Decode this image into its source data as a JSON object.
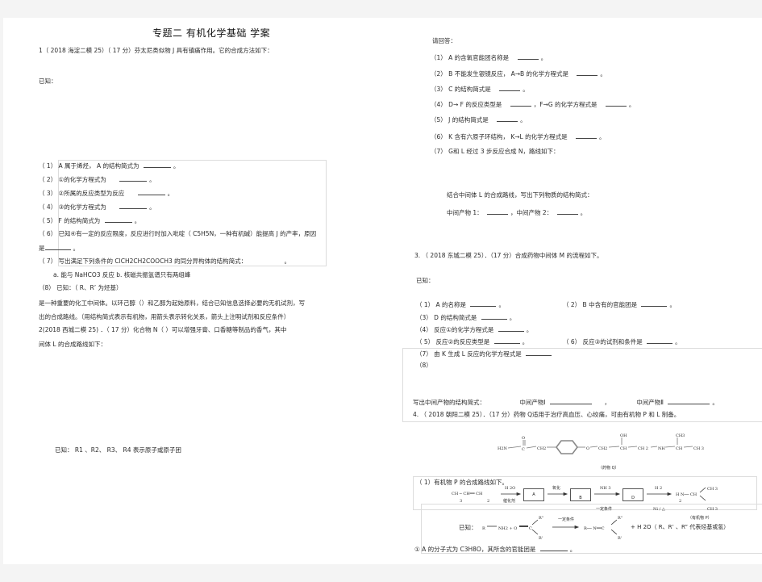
{
  "doc": {
    "title": "专题二  有机化学基础   学案",
    "q1": {
      "header": "1（ 2018 海淀二模  25）（ 17 分）芬太尼类似物  J 具有镇痛作用。它的合成方法如下：",
      "known": "已知：",
      "items": [
        {
          "label": "（ 1）",
          "text": "A 属于烯烃， A 的结构简式为",
          "suffix": "。"
        },
        {
          "label": "（ 2）",
          "text": "①的化学方程式为",
          "suffix": "。"
        },
        {
          "label": "（ 3）",
          "text": "②所属的反应类型为反应",
          "suffix": "。"
        },
        {
          "label": "（ 4）",
          "text": "③的化学方程式为",
          "suffix": "。"
        },
        {
          "label": "（ 5）",
          "text": "F 的结构简式为",
          "suffix": "。"
        },
        {
          "label": "（ 6）",
          "text": "已知④有一定的反应限度，反应进行时加入吡啶（        C5H5N，一种有机碱）能提高    J  的产率，原因"
        },
        {
          "label": "",
          "text": "是",
          "suffix": "。"
        },
        {
          "label": "（ 7）",
          "text": "写出满足下列条件的    ClCH2CH2COOCH3 的同分异构体的结构简式：",
          "suffix": "。"
        },
        {
          "label": "",
          "text": "a. 能与  NaHCO3 反应     b.        核磁共振氢谱只有两组峰"
        },
        {
          "label": "（8）",
          "text": "已知：（ R、R’ 为烃基）"
        }
      ],
      "para1": "是一种重要的化工中间体。以环己醇（）和乙醇为起始原料，结合已知信息选择必要的无机试剂，写",
      "para2": "出的合成路线。（用结构简式表示有机物，用箭头表示转化关系，箭头上注明试剂和反应条件）"
    },
    "q2": {
      "header": "2(2018  西城二模    25)  ．（ 17 分）化合物  N（                   ）可以增强牙膏、口香糖等制品的香气，其中",
      "header2": "间体 L 的合成路线如下：",
      "known": "已知：  R1 、R2、  R3、  R4 表示原子或原子团",
      "please": "请回答：",
      "items": [
        {
          "label": "（1）",
          "text": "A 的含氧官能团名称是",
          "suffix": "。"
        },
        {
          "label": "（2）",
          "text": "B 不能发生银镜反应， A→B 的化学方程式是",
          "suffix": "。"
        },
        {
          "label": "（3）",
          "text": "C 的结构简式是",
          "suffix": "。"
        },
        {
          "label": "（4）",
          "text": "D→ F 的反应类型是",
          "mid": "，F→G 的化学方程式是",
          "suffix": "。"
        },
        {
          "label": "（5）",
          "text": "J 的结构简式是",
          "suffix": "。"
        },
        {
          "label": "（6）",
          "text": "K 含有六原子环结构， K→L 的化学方程式是",
          "suffix": "。"
        },
        {
          "label": "（7）",
          "text": "G和 L 经过 3 步反应合成  N，路线如下："
        }
      ],
      "combine": "结合中间体  L 的合成路线，写出下列物质的结构简式：",
      "intermediate1": "中间产物  1：",
      "intermediate2": "，中间产物  2：",
      "end": "。"
    },
    "q3": {
      "header": "3. （ 2018  东城二模   25）．（17  分）合成药物中间体    M 的流程如下。",
      "known": "已知：",
      "items": [
        {
          "label": "（ 1）",
          "text": "A 的名称是",
          "suffix": "。"
        },
        {
          "label": "（ 2）",
          "text": "B  中含有的官能团是",
          "suffix": "。"
        },
        {
          "label": "（3）",
          "text": "D 的结构简式是",
          "suffix": "。"
        },
        {
          "label": "（4）",
          "text": "反应①的化学方程式是",
          "suffix": "。"
        },
        {
          "label": "（ 5）",
          "text": "反应②的反应类型是",
          "suffix": "。"
        },
        {
          "label": "（ 6）",
          "text": "反应③的试剂和条件是",
          "suffix": "。"
        },
        {
          "label": "（7）",
          "text": "由 K 生成 L 反应的化学方程式是"
        },
        {
          "label": "（8）",
          "text": ""
        }
      ],
      "write": "写出中间产物的结构简式：",
      "mid1": "中间产物Ⅰ",
      "mid2": "中间产物Ⅱ",
      "comma": "，",
      "end": "。"
    },
    "q4": {
      "header": "4. （ 2018  朝阳二模   25）．（17  分）药物  Q适用于治疗高血压、心绞痛，可由有机物      P 和 L 制备。",
      "molecule": {
        "h2n": "H2N",
        "o": "O",
        "c": "C",
        "ch2a": "CH2",
        "oether": "O",
        "ch2b": "CH2",
        "oh": "OH",
        "ch": "CH",
        "ch2c": "CH 2",
        "nh": "NH",
        "ch3top": "CH3",
        "chb": "CH",
        "ch3": "CH 3",
        "caption": "（药物 Q）"
      },
      "p1": "（ 1）有机物  P 的合成路线如下。",
      "route": {
        "start": "CH  ─ CH══ CH",
        "sub3": "3",
        "sub2": "2",
        "h2o": "H 2O",
        "cat": "催化剂",
        "boxA": "A",
        "oxid": "氧化",
        "boxB": "B",
        "nh3": "NH 3",
        "cond1": "一定条件",
        "boxD": "D",
        "h2": "H 2",
        "ni": "Ni / △",
        "prod": "H  N── CH",
        "prodsub": "2",
        "ch3a": "CH 3",
        "ch3b": "CH 3",
        "label": "（有机物  P）"
      },
      "known": {
        "label": "已知：",
        "r": "R",
        "nh2": "NH2 + O",
        "c": "C",
        "rpp": "R''",
        "rp": "R'",
        "cond": "一定条件",
        "product": "R── N══C",
        "rest": "+ H 2O（ R、R’ 、R” 代表烃基或氢）"
      },
      "q1a": "① A 的分子式为  C3H8O，其所含的官能团是",
      "q1a_end": "。"
    }
  }
}
